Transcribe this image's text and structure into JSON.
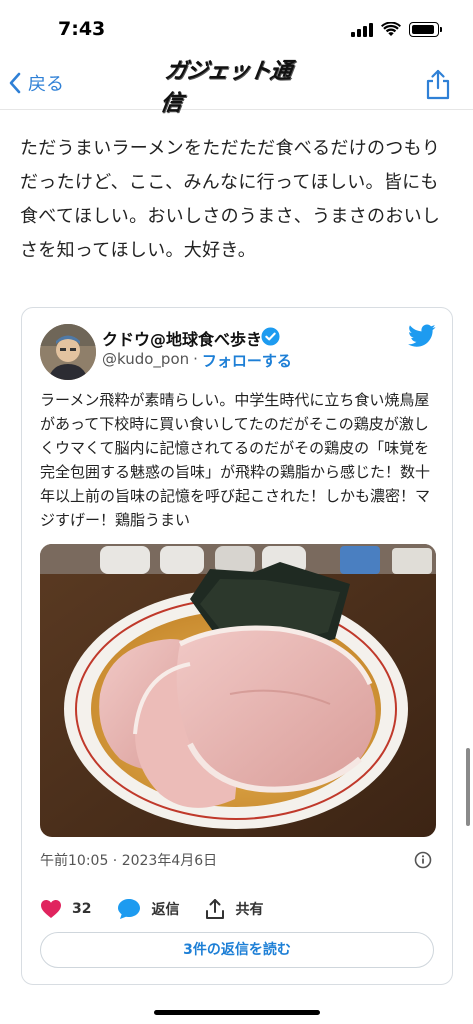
{
  "status_bar": {
    "time": "7:43",
    "battery_level": 0.9
  },
  "nav": {
    "back_label": "戻る",
    "logo_text": "ガジェット通信",
    "icons": [
      "chevron-left-icon",
      "share-icon"
    ]
  },
  "article": {
    "paragraph": "ただうまいラーメンをただただ食べるだけのつもりだったけど、ここ、みんなに行ってほしい。皆にも食べてほしい。おいしさのうまさ、うまさのおいしさを知ってほしい。大好き。"
  },
  "tweet": {
    "author_name": "クドウ@地球食べ歩き",
    "handle": "@kudo_pon",
    "separator": "·",
    "follow_label": "フォローする",
    "body": "ラーメン飛粋が素晴らしい。中学生時代に立ち食い焼鳥屋があって下校時に買い食いしてたのだがそこの鶏皮が激しくウマくて脳内に記憶されてるのだがその鶏皮の「味覚を完全包囲する魅惑の旨味」が飛粋の鶏脂から感じた！数十年以上前の旨味の記憶を呼び起こされた！しかも濃密！マジすげー！鶏脂うまい",
    "timestamp": "午前10:05 · 2023年4月6日",
    "like_count": "32",
    "reply_label": "返信",
    "share_label": "共有",
    "read_replies_label": "3件の返信を読む",
    "icons": [
      "verified-badge-icon",
      "twitter-bird-icon",
      "info-icon",
      "heart-icon",
      "reply-bubble-icon",
      "share-upload-icon"
    ],
    "colors": {
      "link": "#1d7fd6",
      "like": "#e0245e",
      "verified": "#1d9bf0"
    }
  }
}
